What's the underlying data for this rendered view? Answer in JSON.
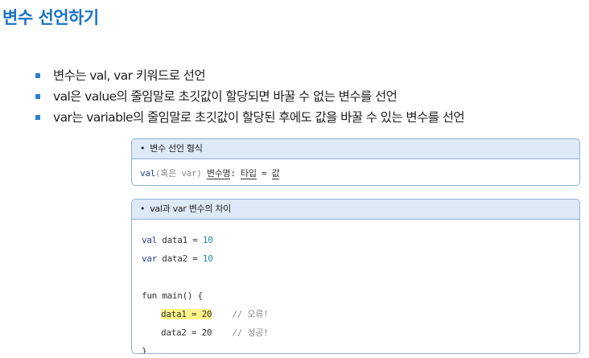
{
  "title": "변수 선언하기",
  "bullets": [
    "변수는 val, var 키워드로 선언",
    "val은 value의 줄임말로 초깃값이 할당되면 바꿀 수 없는 변수를 선언",
    "var는 variable의 줄임말로 초깃값이 할당된 후에도 값을 바꿀 수 있는 변수를 선언"
  ],
  "box1": {
    "header": "변수 선언 형식",
    "syntax": {
      "kw": "val",
      "alt": "(혹은 var)",
      "name": "변수명",
      "colon": ":",
      "type": "타입",
      "eq": "=",
      "value": "값"
    }
  },
  "box2": {
    "header": "val과 var 변수의 차이",
    "code": {
      "l1_kw": "val",
      "l1_rest": " data1 = ",
      "l1_num": "10",
      "l2_kw": "var",
      "l2_rest": " data2 = ",
      "l2_num": "10",
      "l4": "fun main() {",
      "l5_code": "data1 = 20",
      "l5_comment": "// 오류!",
      "l6_code": "data2 = 20",
      "l6_comment": "// 성공!",
      "l7": "}"
    }
  },
  "colors": {
    "title": "#1b73c4",
    "bullet": "#2a7fd4",
    "box_header_bg": "#dde9f7",
    "highlight": "#fff48a"
  }
}
